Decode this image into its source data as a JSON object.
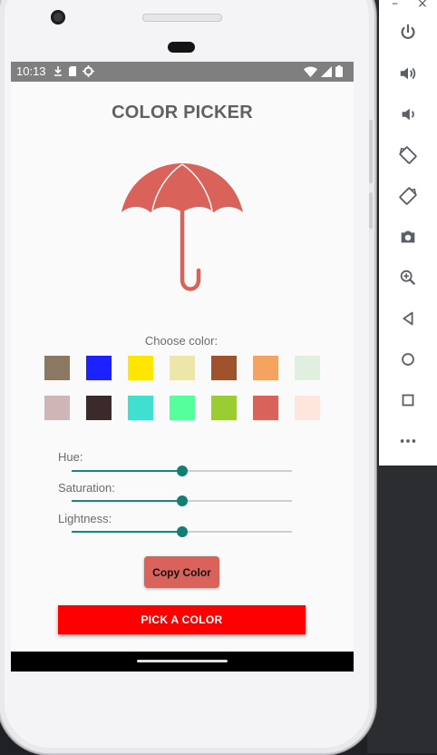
{
  "status_bar": {
    "time": "10:13",
    "left_icons": [
      "download-icon",
      "sd-card-icon",
      "settings-gear-icon"
    ],
    "right_icons": [
      "wifi-icon",
      "signal-icon",
      "battery-icon"
    ]
  },
  "app": {
    "title": "COLOR PICKER",
    "umbrella_color": "#d9625b",
    "choose_label": "Choose color:",
    "swatches": [
      "#8b7762",
      "#1c22ff",
      "#ffe600",
      "#ece6a8",
      "#a0522d",
      "#f4a460",
      "#e0efe0",
      "#cfb6b6",
      "#3b2a2a",
      "#40e0d0",
      "#55ff9c",
      "#9acd32",
      "#d9625b",
      "#fee6df"
    ],
    "sliders": [
      {
        "label": "Hue:",
        "value_fraction": 0.5
      },
      {
        "label": "Saturation:",
        "value_fraction": 0.5
      },
      {
        "label": "Lightness:",
        "value_fraction": 0.5
      }
    ],
    "copy_button": "Copy Color",
    "pick_button": "PICK A COLOR"
  },
  "emulator_toolbar": {
    "window_controls": [
      "–",
      "×"
    ],
    "buttons": [
      "power-icon",
      "volume-up-icon",
      "volume-down-icon",
      "rotate-left-icon",
      "rotate-right-icon",
      "camera-icon",
      "zoom-icon",
      "back-icon",
      "home-icon",
      "overview-icon",
      "more-icon"
    ]
  },
  "colors": {
    "accent_teal": "#137e72",
    "pick_red": "#ff0000"
  }
}
